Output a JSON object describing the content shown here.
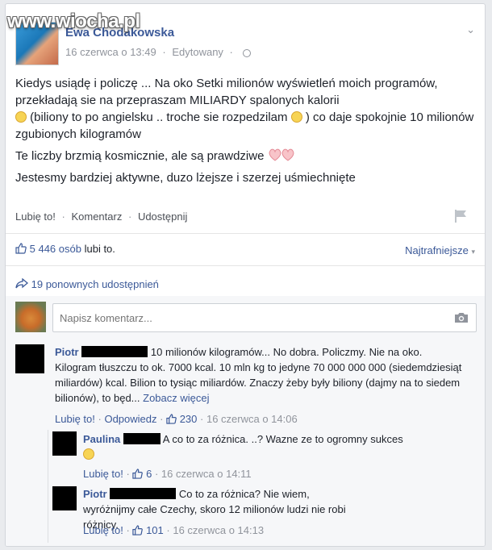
{
  "watermark": "www.wiocha.pl",
  "post": {
    "author": "Ewa Chodakowska",
    "date": "16 czerwca o 13:49",
    "edited": "Edytowany",
    "paragraphs": {
      "p1a": "Kiedys usiądę i policzę ... Na oko Setki milionów wyświetleń moich programów, przekładają sie na przepraszam MILIARDY spalonych kalorii",
      "p1b": "(biliony to po angielsku .. troche sie rozpedzilam",
      "p1c": ") co daje spokojnie 10 milionów zgubionych kilogramów",
      "p2": "Te liczby brzmią kosmicznie, ale są prawdziwe",
      "p3": "Jestesmy bardziej aktywne, duzo lżejsze i szerzej uśmiechnięte"
    },
    "actions": {
      "like": "Lubię to!",
      "comment": "Komentarz",
      "share": "Udostępnij",
      "sep": "·"
    }
  },
  "stats": {
    "likes_count": "5 446 osób",
    "likes_suffix": "lubi to.",
    "sort": "Najtrafniejsze",
    "shares": "19 ponownych udostępnień"
  },
  "comment_box": {
    "placeholder": "Napisz komentarz..."
  },
  "comments": [
    {
      "name": "Piotr",
      "text": "10 milionów kilogramów... No dobra. Policzmy. Nie na oko. Kilogram tłuszczu to ok. 7000 kcal. 10 mln kg to jedyne 70 000 000 000 (siedemdziesiąt miliardów) kcal. Bilion to tysiąc miliardów. Znaczy żeby były biliony (dajmy na to siedem bilionów), to będ...",
      "more": "Zobacz więcej",
      "like": "Lubię to!",
      "reply": "Odpowiedz",
      "likes": "230",
      "date": "16 czerwca o 14:06"
    },
    {
      "name": "Paulina",
      "text": "A co to za różnica. ..? Wazne ze to ogromny sukces",
      "like": "Lubię to!",
      "likes": "6",
      "date": "16 czerwca o 14:11"
    },
    {
      "name": "Piotr",
      "text": "Co to za różnica? Nie wiem, wyróżnijmy całe Czechy, skoro 12 milionów ludzi nie robi różnicy.",
      "like": "Lubię to!",
      "likes": "101",
      "date": "16 czerwca o 14:13"
    }
  ],
  "colors": {
    "link": "#3b5998",
    "muted": "#90949c",
    "background": "#e9ebee"
  },
  "icons": [
    "globe-icon",
    "chevron-down-icon",
    "smiley-icon",
    "sad-face-icon",
    "hearts-icon",
    "flag-icon",
    "thumbs-up-icon",
    "share-arrow-icon",
    "camera-icon"
  ]
}
